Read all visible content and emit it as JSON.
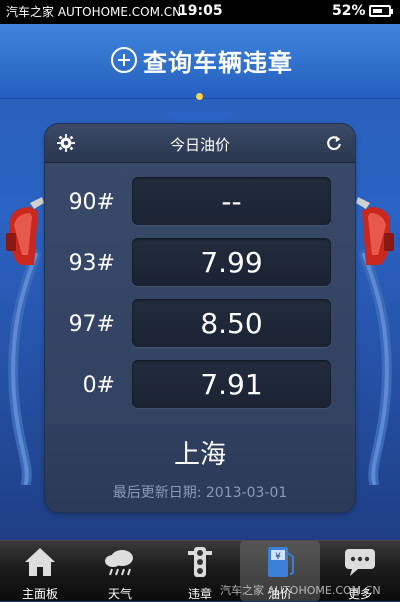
{
  "status_bar": {
    "time": "19:05",
    "battery_percent": "52%"
  },
  "header": {
    "query_label": "查询车辆违章"
  },
  "card": {
    "title": "今日油价",
    "rows": [
      {
        "grade": "90#",
        "price": "--"
      },
      {
        "grade": "93#",
        "price": "7.99"
      },
      {
        "grade": "97#",
        "price": "8.50"
      },
      {
        "grade": "0#",
        "price": "7.91"
      }
    ],
    "city": "上海",
    "updated": "最后更新日期: 2013-03-01"
  },
  "tabs": [
    {
      "label": "主面板",
      "icon": "home-icon"
    },
    {
      "label": "天气",
      "icon": "weather-icon"
    },
    {
      "label": "违章",
      "icon": "traffic-light-icon"
    },
    {
      "label": "油价",
      "icon": "fuel-icon",
      "active": true
    },
    {
      "label": "更多",
      "icon": "more-icon"
    }
  ],
  "watermark": {
    "top": "汽车之家 AUTOHOME.COM.CN",
    "bottom": "汽车之家 AUTOHOME.COM.CN"
  },
  "colors": {
    "accent_blue": "#2f6fc9",
    "pump_red": "#c8281e",
    "dot_yellow": "#f7d24b"
  }
}
